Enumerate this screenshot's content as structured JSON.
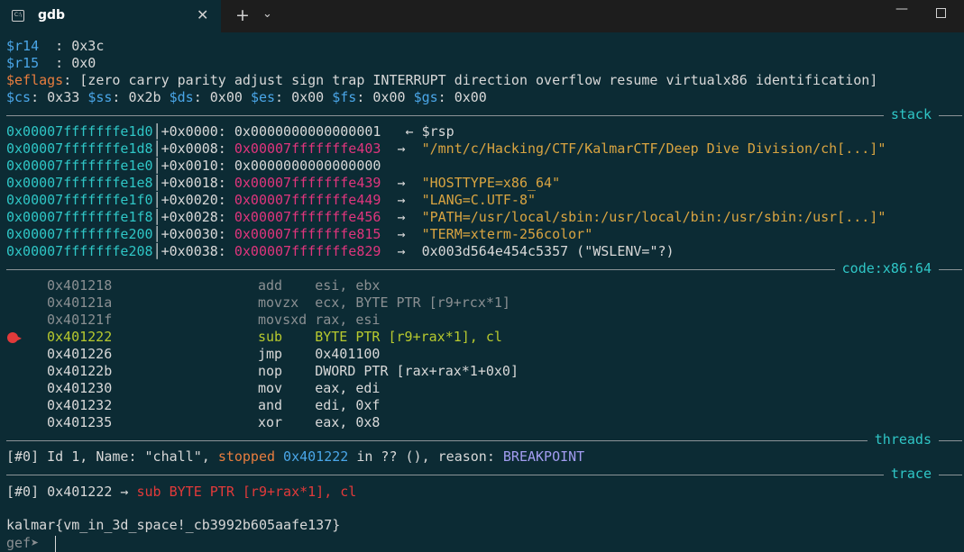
{
  "window": {
    "tab_title": "gdb",
    "tab_icon": "terminal-icon",
    "tab_close": "✕",
    "new_tab": "+",
    "dropdown": "⌄",
    "minimize": "—"
  },
  "registers": {
    "r14_name": "$r14",
    "r14_sep": "  : ",
    "r14_val": "0x3c",
    "r15_name": "$r15",
    "r15_sep": "  : ",
    "r15_val": "0x0",
    "eflags_name": "$eflags",
    "eflags_val": ": [zero carry parity adjust sign trap INTERRUPT direction overflow resume virtualx86 identification]",
    "cs_name": "$cs",
    "cs_val": ": 0x33 ",
    "ss_name": "$ss",
    "ss_val": ": 0x2b ",
    "ds_name": "$ds",
    "ds_val": ": 0x00 ",
    "es_name": "$es",
    "es_val": ": 0x00 ",
    "fs_name": "$fs",
    "fs_val": ": 0x00 ",
    "gs_name": "$gs",
    "gs_val": ": 0x00"
  },
  "sections": {
    "stack": "stack",
    "code": "code:x86:64",
    "threads": "threads",
    "trace": "trace"
  },
  "stack": [
    {
      "addr": "0x00007fffffffe1d0",
      "off": "│+0x0000: ",
      "val": "0x0000000000000001",
      "arrow": "   ← ",
      "note": "$rsp",
      "val_color": "white",
      "note_color": "white"
    },
    {
      "addr": "0x00007fffffffe1d8",
      "off": "│+0x0008: ",
      "val": "0x00007fffffffe403",
      "arrow": "  →  ",
      "note": "\"/mnt/c/Hacking/CTF/KalmarCTF/Deep Dive Division/ch[...]\"",
      "val_color": "magenta",
      "note_color": "yellow"
    },
    {
      "addr": "0x00007fffffffe1e0",
      "off": "│+0x0010: ",
      "val": "0x0000000000000000",
      "arrow": "",
      "note": "",
      "val_color": "white",
      "note_color": "white"
    },
    {
      "addr": "0x00007fffffffe1e8",
      "off": "│+0x0018: ",
      "val": "0x00007fffffffe439",
      "arrow": "  →  ",
      "note": "\"HOSTTYPE=x86_64\"",
      "val_color": "magenta",
      "note_color": "yellow"
    },
    {
      "addr": "0x00007fffffffe1f0",
      "off": "│+0x0020: ",
      "val": "0x00007fffffffe449",
      "arrow": "  →  ",
      "note": "\"LANG=C.UTF-8\"",
      "val_color": "magenta",
      "note_color": "yellow"
    },
    {
      "addr": "0x00007fffffffe1f8",
      "off": "│+0x0028: ",
      "val": "0x00007fffffffe456",
      "arrow": "  →  ",
      "note": "\"PATH=/usr/local/sbin:/usr/local/bin:/usr/sbin:/usr[...]\"",
      "val_color": "magenta",
      "note_color": "yellow"
    },
    {
      "addr": "0x00007fffffffe200",
      "off": "│+0x0030: ",
      "val": "0x00007fffffffe815",
      "arrow": "  →  ",
      "note": "\"TERM=xterm-256color\"",
      "val_color": "magenta",
      "note_color": "yellow"
    },
    {
      "addr": "0x00007fffffffe208",
      "off": "│+0x0038: ",
      "val": "0x00007fffffffe829",
      "arrow": "  →  ",
      "note": "0x003d564e454c5357 (\"WSLENV=\"?)",
      "val_color": "magenta",
      "note_color": "white"
    }
  ],
  "code": [
    {
      "addr": "0x401218",
      "mn": "add   ",
      "ops": " esi, ebx",
      "color": "gray"
    },
    {
      "addr": "0x40121a",
      "mn": "movzx ",
      "ops": " ecx, BYTE PTR [r9+rcx*1]",
      "color": "gray"
    },
    {
      "addr": "0x40121f",
      "mn": "movsxd",
      "ops": " rax, esi",
      "color": "gray"
    },
    {
      "addr": "0x401222",
      "mn": "sub   ",
      "ops": " BYTE PTR [r9+rax*1], cl",
      "color": "lime"
    },
    {
      "addr": "0x401226",
      "mn": "jmp   ",
      "ops": " 0x401100",
      "color": "white"
    },
    {
      "addr": "0x40122b",
      "mn": "nop   ",
      "ops": " DWORD PTR [rax+rax*1+0x0]",
      "color": "white"
    },
    {
      "addr": "0x401230",
      "mn": "mov   ",
      "ops": " eax, edi",
      "color": "white"
    },
    {
      "addr": "0x401232",
      "mn": "and   ",
      "ops": " edi, 0xf",
      "color": "white"
    },
    {
      "addr": "0x401235",
      "mn": "xor   ",
      "ops": " eax, 0x8",
      "color": "white"
    }
  ],
  "threads": {
    "prefix": "[#0] Id 1, Name: \"chall\", ",
    "state": "stopped",
    "addr": " 0x401222",
    "mid": " in ?? (), reason: ",
    "reason": "BREAKPOINT"
  },
  "trace": {
    "prefix": "[#0] 0x401222 → ",
    "instr": "sub BYTE PTR [r9+rax*1], cl"
  },
  "output": "kalmar{vm_in_3d_space!_cb3992b605aafe137}",
  "prompt": "gef➤ ",
  "colors": {
    "background": "#0c2b34",
    "register": "#4aa6e8",
    "address": "#2fc6c6",
    "pointer": "#e0357d",
    "string": "#d9a441",
    "current": "#b7c92e"
  }
}
